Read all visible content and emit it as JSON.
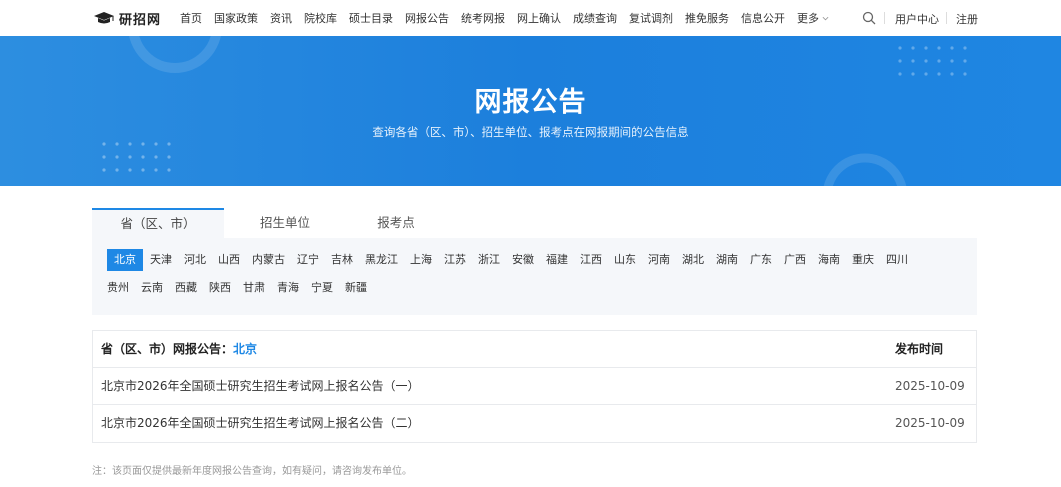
{
  "nav": {
    "logo_text": "研招网",
    "items": [
      "首页",
      "国家政策",
      "资讯",
      "院校库",
      "硕士目录",
      "网报公告",
      "统考网报",
      "网上确认",
      "成绩查询",
      "复试调剂",
      "推免服务",
      "信息公开"
    ],
    "more_label": "更多",
    "user_center": "用户中心",
    "register": "注册"
  },
  "banner": {
    "title": "网报公告",
    "subtitle": "查询各省（区、市）、招生单位、报考点在网报期间的公告信息"
  },
  "tabs": [
    "省（区、市）",
    "招生单位",
    "报考点"
  ],
  "provinces_row1": [
    "北京",
    "天津",
    "河北",
    "山西",
    "内蒙古",
    "辽宁",
    "吉林",
    "黑龙江",
    "上海",
    "江苏",
    "浙江",
    "安徽",
    "福建",
    "江西",
    "山东",
    "河南",
    "湖北",
    "湖南",
    "广东",
    "广西",
    "海南",
    "重庆",
    "四川"
  ],
  "provinces_row2": [
    "贵州",
    "云南",
    "西藏",
    "陕西",
    "甘肃",
    "青海",
    "宁夏",
    "新疆"
  ],
  "table": {
    "header_prefix": "省（区、市）网报公告：",
    "header_selected": "北京",
    "header_date": "发布时间",
    "rows": [
      {
        "title": "北京市2026年全国硕士研究生招生考试网上报名公告（一）",
        "date": "2025-10-09"
      },
      {
        "title": "北京市2026年全国硕士研究生招生考试网上报名公告（二）",
        "date": "2025-10-09"
      }
    ]
  },
  "note": "注：该页面仅提供最新年度网报公告查询，如有疑问，请咨询发布单位。",
  "colors": {
    "accent": "#1e88e5",
    "banner_bg": "#1c7fdc"
  }
}
